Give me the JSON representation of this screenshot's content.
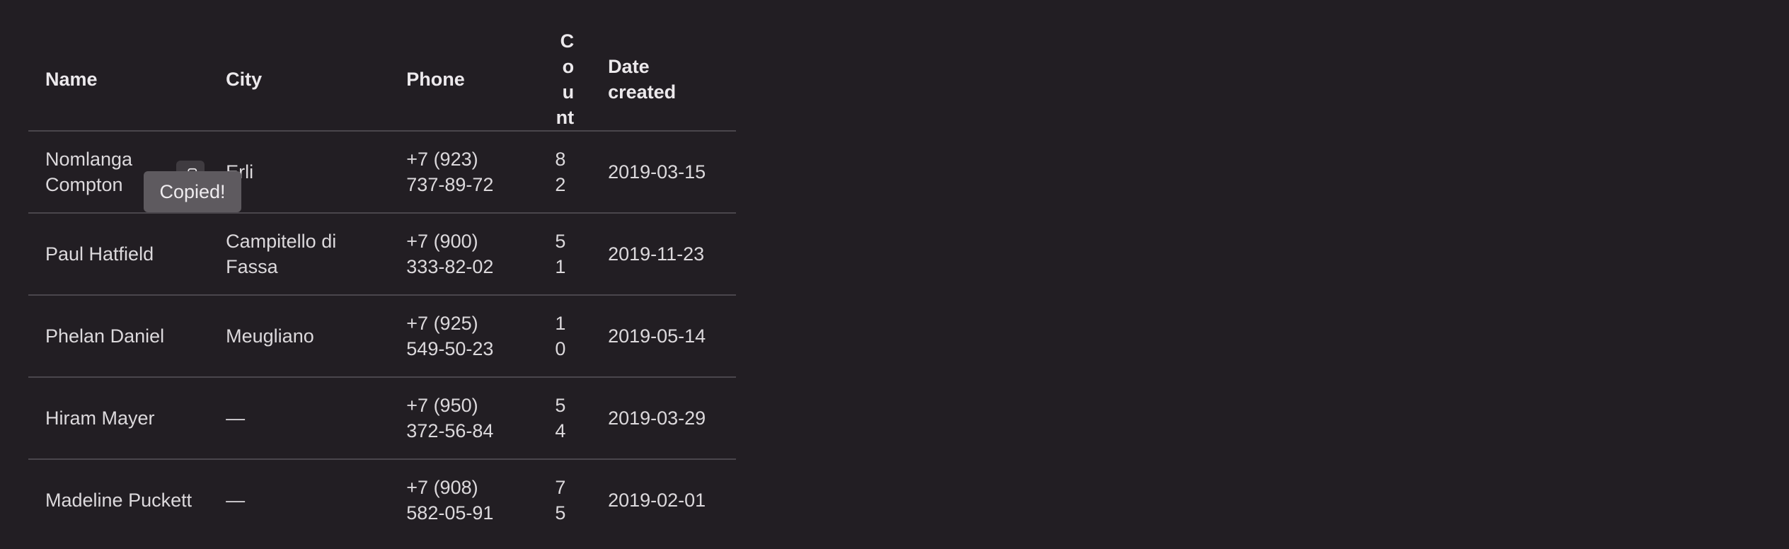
{
  "table": {
    "headers": {
      "name": "Name",
      "city": "City",
      "phone": "Phone",
      "count": "Count",
      "date": "Date created"
    },
    "rows": [
      {
        "name": "Nomlanga Compton",
        "city": "Erli",
        "phone": "+7 (923) 737-89-72",
        "count": "82",
        "date": "2019-03-15"
      },
      {
        "name": "Paul Hatfield",
        "city": "Campitello di Fassa",
        "phone": "+7 (900) 333-82-02",
        "count": "51",
        "date": "2019-11-23"
      },
      {
        "name": "Phelan Daniel",
        "city": "Meugliano",
        "phone": "+7 (925) 549-50-23",
        "count": "10",
        "date": "2019-05-14"
      },
      {
        "name": "Hiram Mayer",
        "city": "—",
        "phone": "+7 (950) 372-56-84",
        "count": "54",
        "date": "2019-03-29"
      },
      {
        "name": "Madeline Puckett",
        "city": "—",
        "phone": "+7 (908) 582-05-91",
        "count": "75",
        "date": "2019-02-01"
      }
    ]
  },
  "tooltip": {
    "text": "Copied!"
  },
  "icons": {
    "copy": "copy-icon"
  }
}
